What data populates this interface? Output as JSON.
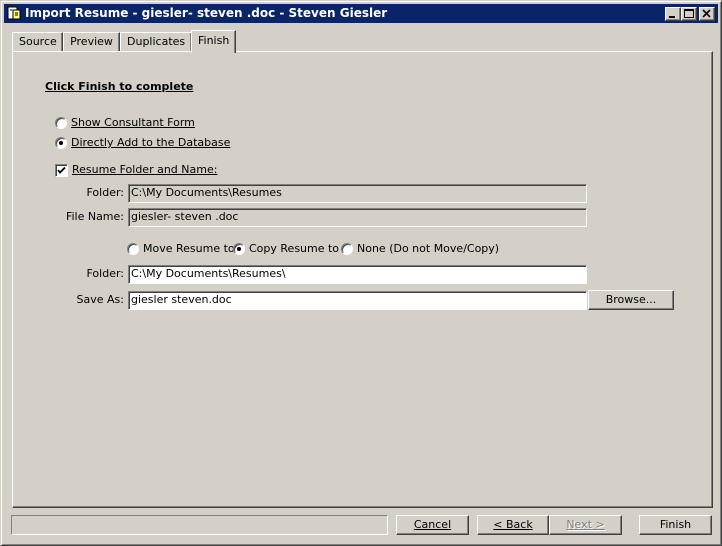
{
  "window": {
    "title": "Import Resume - giesler- steven .doc - Steven Giesler"
  },
  "title_buttons": {
    "minimize_icon": "minimize-icon",
    "maximize_icon": "maximize-icon",
    "close_icon": "close-icon"
  },
  "tabs": [
    {
      "label": "Source"
    },
    {
      "label": "Preview"
    },
    {
      "label": "Duplicates"
    },
    {
      "label": "Finish",
      "active": true
    }
  ],
  "finish": {
    "heading": "Click Finish to complete",
    "options": [
      {
        "label": "Show Consultant Form",
        "selected": false
      },
      {
        "label": "Directly Add to the Database",
        "selected": true
      }
    ],
    "resume_folder_checkbox": {
      "label": "Resume Folder and Name:",
      "checked": true
    },
    "folder_label": "Folder:",
    "folder_value": "C:\\My Documents\\Resumes",
    "file_name_label": "File Name:",
    "file_name_value": "giesler- steven .doc",
    "action_options": [
      {
        "label": "Move Resume to",
        "selected": false
      },
      {
        "label": "Copy Resume to",
        "selected": true
      },
      {
        "label": "None (Do not Move/Copy)",
        "selected": false
      }
    ],
    "dest_folder_label": "Folder:",
    "dest_folder_value": "C:\\My Documents\\Resumes\\",
    "save_as_label": "Save As:",
    "save_as_value": "giesler steven.doc",
    "browse_label": "Browse..."
  },
  "footer": {
    "status_text": "",
    "cancel_label": "Cancel",
    "back_label": "< Back",
    "next_label": "Next >",
    "finish_label": "Finish"
  },
  "colors": {
    "face": "#d4d0c8",
    "titlebar": "#0a246a"
  }
}
